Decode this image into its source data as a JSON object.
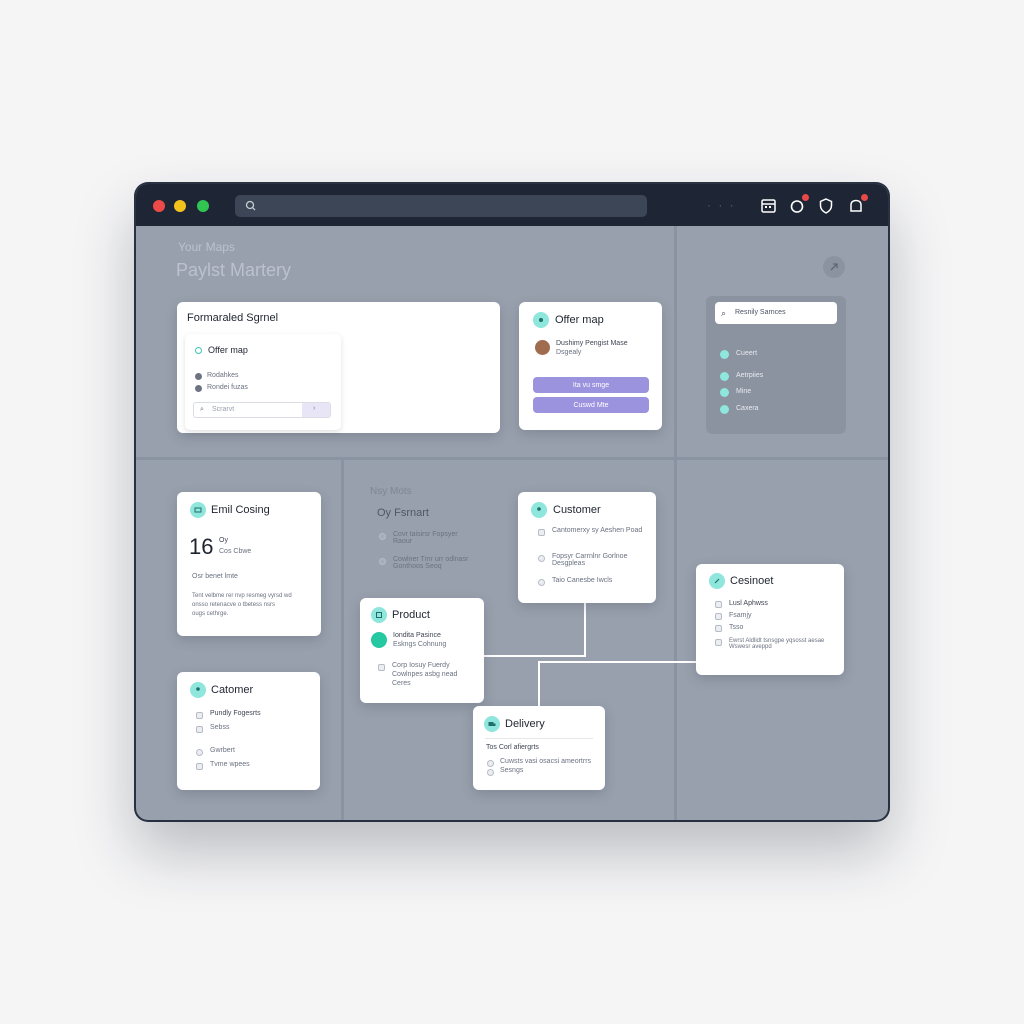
{
  "window": {
    "header_small": "Your Maps",
    "header_title": "Paylst Martery"
  },
  "titlebar": {
    "search_placeholder": "",
    "more_dots": "· · ·"
  },
  "cards": {
    "formatted": {
      "title": "Formaraled Sgrnel",
      "inner_title": "Offer map",
      "items": [
        "Rodahkes",
        "Rondei fuzas"
      ],
      "input_placeholder": "Scrarvt"
    },
    "offer": {
      "title": "Offer map",
      "person_line1": "Dushimy Pengist Mase",
      "person_line2": "Dsgealy",
      "btn1": "Ita vu smge",
      "btn2": "Cuswd Mte"
    },
    "email": {
      "title": "Emil Cosing",
      "big_number": "16",
      "num_label1": "Oy",
      "num_label2": "Cos Cbwe",
      "subtitle": "Osr benet lmte",
      "body_lines": [
        "Tent velbme rer nvp resmeg vyrsd wd",
        "onsso retenacve o tbetess nsrs",
        "ougs cethrge."
      ]
    },
    "customer_left": {
      "title": "Catomer",
      "items": [
        "Pundly Fogesrts",
        "Sebss",
        "Gwrbert",
        "Tvme wpees"
      ]
    },
    "product": {
      "title": "Product",
      "highlight_line1": "Iondita Pasince",
      "highlight_line2": "Eskngs Cohnung",
      "items": [
        "Corp Iosuy Fuerdy",
        "Cowlnpes asbg nead",
        "Ceres"
      ]
    },
    "customer_center": {
      "title": "Customer",
      "items": [
        "Cantomerxy sy Aeshen Poad",
        "Fopsyr Carrnlnr Gorlnoe Desgpleas",
        "Taio Canesbe Iwcls"
      ]
    },
    "delivery": {
      "title": "Delivery",
      "heading": "Tos Corl afiergrts",
      "items": [
        "Cuwsts vasi osacsi ameortrrs",
        "Sesngs"
      ]
    },
    "right": {
      "title": "Cesinoet",
      "items": [
        "Lusl Aphwss",
        "Fsamjy",
        "Tsso",
        "Ewrst Aldlidt tsnsgpe yqsosst aesae Wswesr aveppd"
      ]
    }
  },
  "bg_panel": {
    "label_small": "Nsy Mots",
    "label": "Oy Fsrnart",
    "items": [
      "Covr taisirsr Fopsyer Raour",
      "Cowlner Tmr urr odlnasr Gonthoos Seoq"
    ]
  },
  "side_panel": {
    "search_text": "Resnily Sarnces",
    "items": [
      "Cueert",
      "Aetrpiies",
      "Mine",
      "Caxera"
    ]
  },
  "colors": {
    "accent": "#8ee6dc",
    "button": "#9c93df",
    "titlebar": "#1e2535",
    "canvas": "#98a0ad"
  }
}
